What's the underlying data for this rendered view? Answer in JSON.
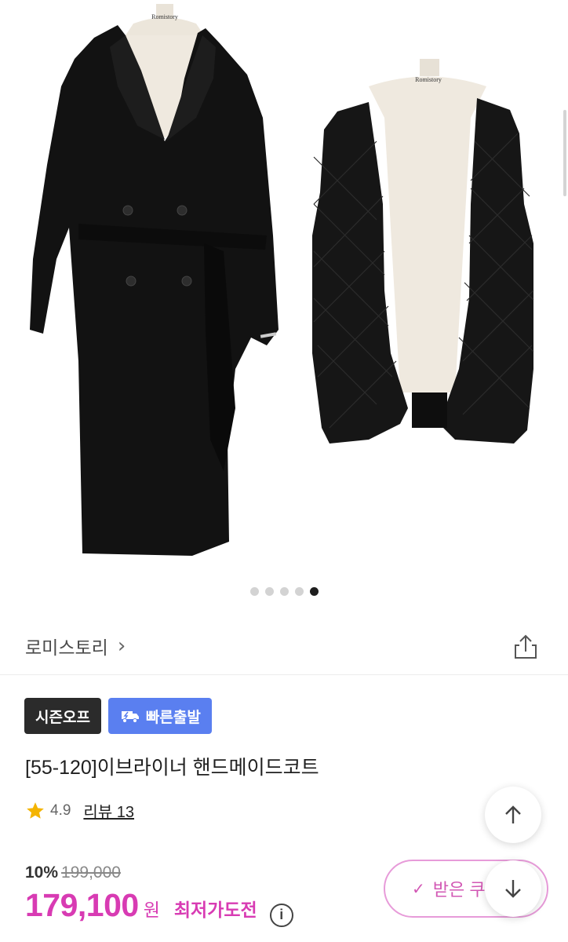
{
  "gallery": {
    "dots_total": 5,
    "active_index": 4,
    "mannequin_tag": "Romistory"
  },
  "brand": {
    "name": "로미스토리",
    "chevron": "›"
  },
  "badges": {
    "season_off": "시즌오프",
    "fast_delivery": "빠른출발"
  },
  "product": {
    "title": "[55-120]이브라이너 핸드메이드코트",
    "rating": "4.9",
    "review_label": "리뷰 13"
  },
  "price": {
    "discount_rate": "10%",
    "original": "199,000",
    "sale": "179,100",
    "currency": "원",
    "lowest_challenge": "최저가도전",
    "info": "i"
  },
  "coupon": {
    "check": "✓",
    "label": "받은 쿠"
  },
  "colors": {
    "accent_pink": "#d83bb3",
    "badge_blue": "#5a7ff0",
    "badge_dark": "#2b2b2b",
    "star": "#f4b400"
  },
  "icons": [
    "chevron-right-icon",
    "share-icon",
    "lightning-truck-icon",
    "star-icon",
    "info-icon",
    "check-icon",
    "arrow-up-icon",
    "arrow-down-icon"
  ]
}
